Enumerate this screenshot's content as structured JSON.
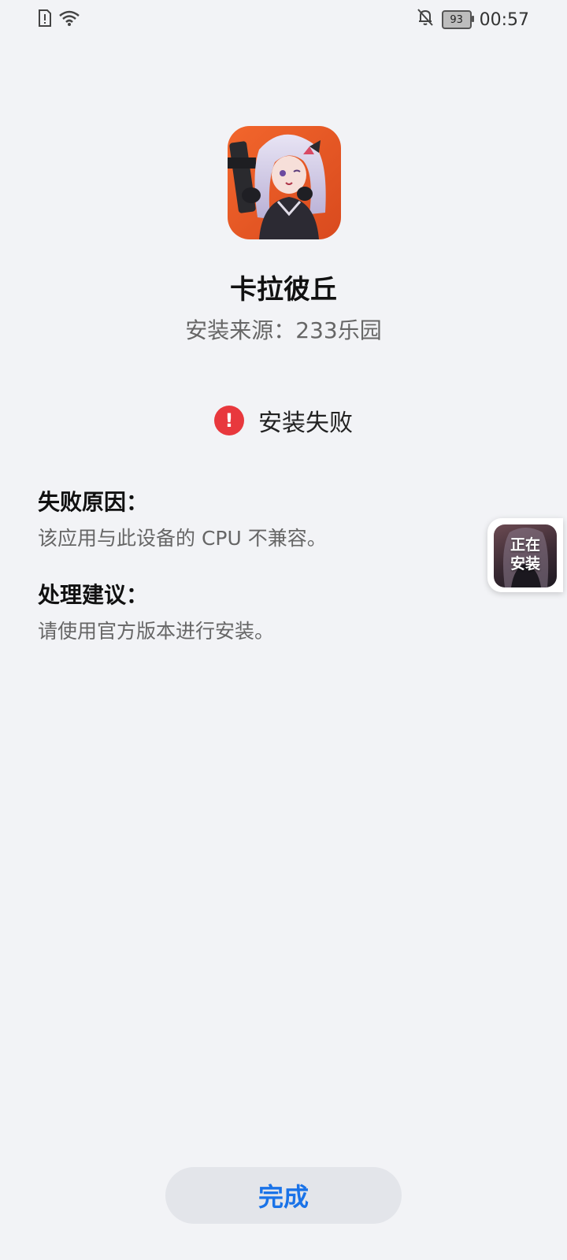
{
  "status_bar": {
    "time": "00:57",
    "battery_level": "93",
    "icons": [
      "sim-alert-icon",
      "wifi-icon",
      "bell-off-icon",
      "battery-icon"
    ]
  },
  "app": {
    "name": "卡拉彼丘",
    "source": "安装来源：233乐园"
  },
  "install": {
    "status": "安装失败",
    "status_icon": "error-exclamation-icon",
    "status_color": "#e8383d"
  },
  "failure": {
    "reason_title": "失败原因：",
    "reason_text": "该应用与此设备的 CPU 不兼容。",
    "suggestion_title": "处理建议：",
    "suggestion_text": "请使用官方版本进行安装。"
  },
  "floating_widget": {
    "label_line1": "正在",
    "label_line2": "安装"
  },
  "actions": {
    "done_label": "完成"
  },
  "colors": {
    "background": "#f2f3f6",
    "accent": "#1a73e8"
  }
}
